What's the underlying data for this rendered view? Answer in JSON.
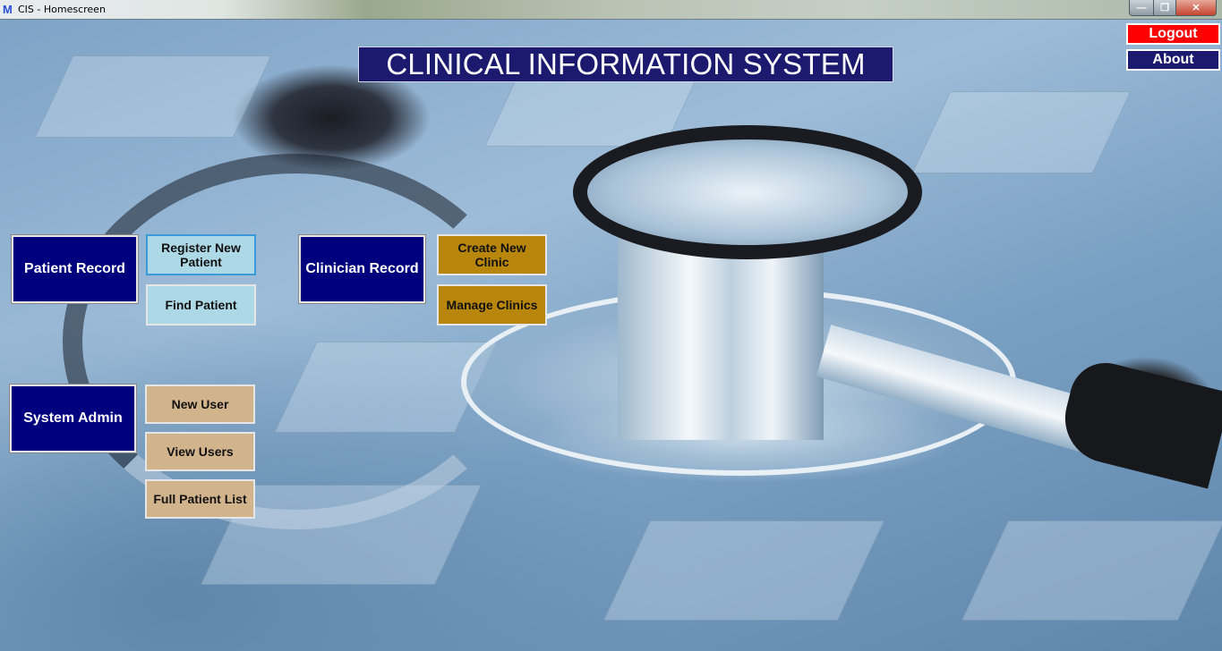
{
  "window": {
    "title": "CIS - Homescreen",
    "app_icon_glyph": "M",
    "controls": {
      "minimize": "—",
      "maximize": "❐",
      "close": "✕"
    }
  },
  "header": {
    "title": "CLINICAL INFORMATION SYSTEM"
  },
  "top_actions": {
    "logout_label": "Logout",
    "about_label": "About"
  },
  "sections": {
    "patient": {
      "label": "Patient Record",
      "actions": [
        "Register New Patient",
        "Find Patient"
      ]
    },
    "clinician": {
      "label": "Clinician Record",
      "actions": [
        "Create New Clinic",
        "Manage Clinics"
      ]
    },
    "admin": {
      "label": "System Admin",
      "actions": [
        "New User",
        "View Users",
        "Full Patient List"
      ]
    }
  },
  "colors": {
    "title_bg": "#1b1a6e",
    "category_bg": "#00007f",
    "patient_action_bg": "#add8e6",
    "clinician_action_bg": "#b8860b",
    "admin_action_bg": "#d2b48c",
    "logout_bg": "#ff0000",
    "about_bg": "#1b1a6e"
  }
}
